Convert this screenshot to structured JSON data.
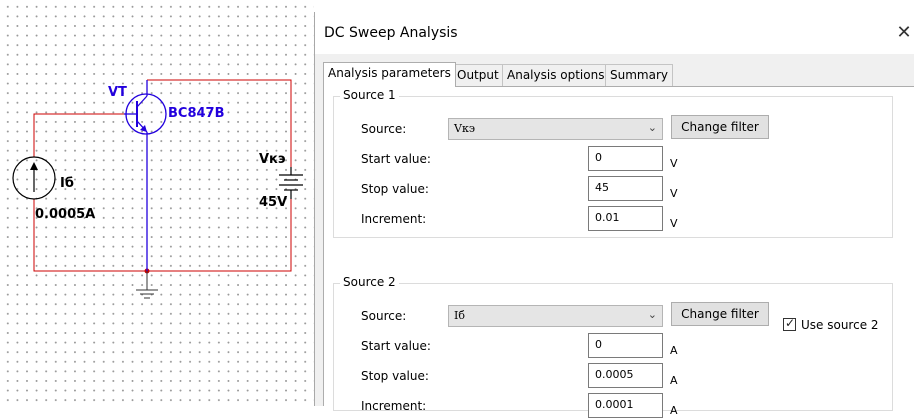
{
  "schematic": {
    "transistor_ref": "VT",
    "transistor_model": "BC847B",
    "current_source_name": "Iб",
    "current_source_value": "0.0005A",
    "voltage_source_name": "Vкэ",
    "voltage_source_value": "45V",
    "wire_color": "#cc0000",
    "label_color": "#2200dd",
    "source_color": "#000000"
  },
  "dialog": {
    "title": "DC Sweep Analysis",
    "close_glyph": "✕",
    "tabs": [
      "Analysis parameters",
      "Output",
      "Analysis options",
      "Summary"
    ],
    "active_tab": "Analysis parameters",
    "use_source2_label": "Use source 2",
    "use_source2_checked": true,
    "change_filter_label": "Change filter",
    "dropdown_icon": "chevron-down-icon",
    "labels": {
      "source": "Source:",
      "start": "Start value:",
      "stop": "Stop value:",
      "increment": "Increment:"
    },
    "source1": {
      "title": "Source 1",
      "source": "Vкэ",
      "start": "0",
      "stop": "45",
      "increment": "0.01",
      "unit": "V"
    },
    "source2": {
      "title": "Source 2",
      "source": "Iб",
      "start": "0",
      "stop": "0.0005",
      "increment": "0.0001",
      "unit": "A"
    }
  }
}
